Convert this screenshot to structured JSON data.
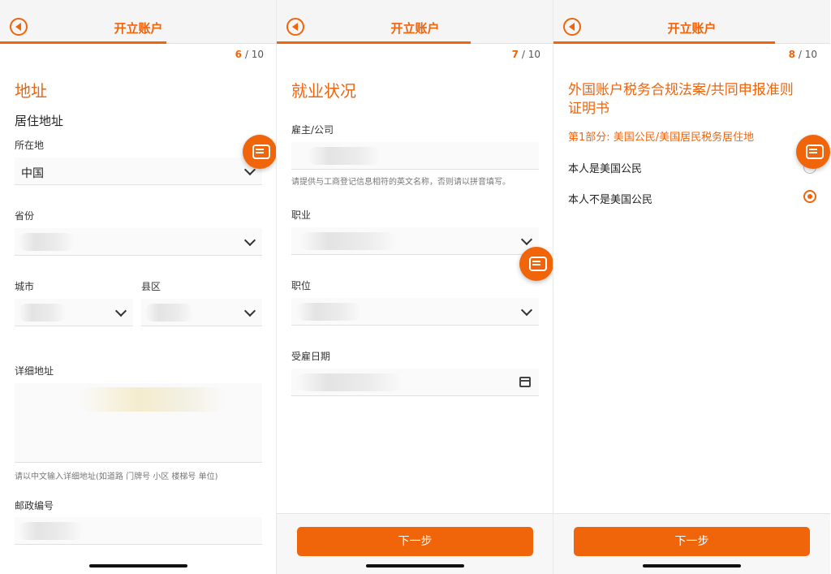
{
  "panels": [
    {
      "title": "开立账户",
      "step_current": "6",
      "step_total": "/ 10",
      "heading": "地址",
      "section": "居住地址",
      "fields": {
        "location_label": "所在地",
        "location_value": "中国",
        "province_label": "省份",
        "city_label": "城市",
        "district_label": "县区",
        "detail_label": "详细地址",
        "detail_hint": "请以中文输入详细地址(如道路 门牌号 小区 楼梯号 单位)",
        "postal_label": "邮政编号"
      }
    },
    {
      "title": "开立账户",
      "step_current": "7",
      "step_total": "/ 10",
      "heading": "就业状况",
      "fields": {
        "employer_label": "雇主/公司",
        "employer_hint": "请提供与工商登记信息相符的英文名称，否则请以拼音填写。",
        "occupation_label": "职业",
        "position_label": "职位",
        "hire_date_label": "受雇日期"
      },
      "next_label": "下一步"
    },
    {
      "title": "开立账户",
      "step_current": "8",
      "step_total": "/ 10",
      "heading_line1": "外国账户税务合规法案/共同申报准则",
      "heading_line2": "证明书",
      "subheading": "第1部分: 美国公民/美国居民税务居住地",
      "options": [
        {
          "label": "本人是美国公民",
          "selected": false
        },
        {
          "label": "本人不是美国公民",
          "selected": true
        }
      ],
      "next_label": "下一步"
    }
  ],
  "colors": {
    "accent": "#f0640a"
  },
  "icons": {
    "back": "back-circle-icon",
    "chat": "chat-bubble-icon",
    "chevron": "chevron-down-icon",
    "calendar": "calendar-icon"
  }
}
